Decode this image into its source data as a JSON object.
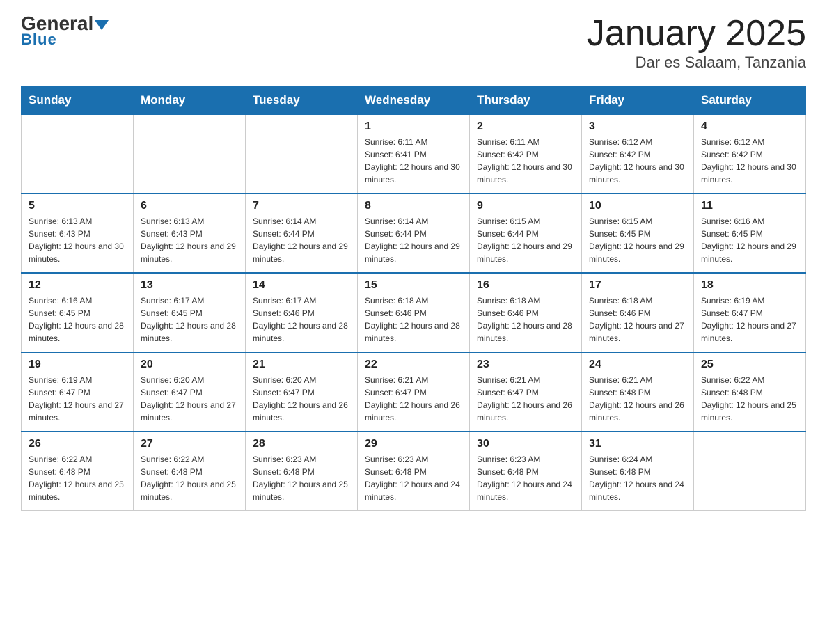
{
  "header": {
    "logo_main": "General",
    "logo_sub": "Blue",
    "month_title": "January 2025",
    "location": "Dar es Salaam, Tanzania"
  },
  "weekdays": [
    "Sunday",
    "Monday",
    "Tuesday",
    "Wednesday",
    "Thursday",
    "Friday",
    "Saturday"
  ],
  "weeks": [
    [
      {
        "day": "",
        "info": ""
      },
      {
        "day": "",
        "info": ""
      },
      {
        "day": "",
        "info": ""
      },
      {
        "day": "1",
        "info": "Sunrise: 6:11 AM\nSunset: 6:41 PM\nDaylight: 12 hours and 30 minutes."
      },
      {
        "day": "2",
        "info": "Sunrise: 6:11 AM\nSunset: 6:42 PM\nDaylight: 12 hours and 30 minutes."
      },
      {
        "day": "3",
        "info": "Sunrise: 6:12 AM\nSunset: 6:42 PM\nDaylight: 12 hours and 30 minutes."
      },
      {
        "day": "4",
        "info": "Sunrise: 6:12 AM\nSunset: 6:42 PM\nDaylight: 12 hours and 30 minutes."
      }
    ],
    [
      {
        "day": "5",
        "info": "Sunrise: 6:13 AM\nSunset: 6:43 PM\nDaylight: 12 hours and 30 minutes."
      },
      {
        "day": "6",
        "info": "Sunrise: 6:13 AM\nSunset: 6:43 PM\nDaylight: 12 hours and 29 minutes."
      },
      {
        "day": "7",
        "info": "Sunrise: 6:14 AM\nSunset: 6:44 PM\nDaylight: 12 hours and 29 minutes."
      },
      {
        "day": "8",
        "info": "Sunrise: 6:14 AM\nSunset: 6:44 PM\nDaylight: 12 hours and 29 minutes."
      },
      {
        "day": "9",
        "info": "Sunrise: 6:15 AM\nSunset: 6:44 PM\nDaylight: 12 hours and 29 minutes."
      },
      {
        "day": "10",
        "info": "Sunrise: 6:15 AM\nSunset: 6:45 PM\nDaylight: 12 hours and 29 minutes."
      },
      {
        "day": "11",
        "info": "Sunrise: 6:16 AM\nSunset: 6:45 PM\nDaylight: 12 hours and 29 minutes."
      }
    ],
    [
      {
        "day": "12",
        "info": "Sunrise: 6:16 AM\nSunset: 6:45 PM\nDaylight: 12 hours and 28 minutes."
      },
      {
        "day": "13",
        "info": "Sunrise: 6:17 AM\nSunset: 6:45 PM\nDaylight: 12 hours and 28 minutes."
      },
      {
        "day": "14",
        "info": "Sunrise: 6:17 AM\nSunset: 6:46 PM\nDaylight: 12 hours and 28 minutes."
      },
      {
        "day": "15",
        "info": "Sunrise: 6:18 AM\nSunset: 6:46 PM\nDaylight: 12 hours and 28 minutes."
      },
      {
        "day": "16",
        "info": "Sunrise: 6:18 AM\nSunset: 6:46 PM\nDaylight: 12 hours and 28 minutes."
      },
      {
        "day": "17",
        "info": "Sunrise: 6:18 AM\nSunset: 6:46 PM\nDaylight: 12 hours and 27 minutes."
      },
      {
        "day": "18",
        "info": "Sunrise: 6:19 AM\nSunset: 6:47 PM\nDaylight: 12 hours and 27 minutes."
      }
    ],
    [
      {
        "day": "19",
        "info": "Sunrise: 6:19 AM\nSunset: 6:47 PM\nDaylight: 12 hours and 27 minutes."
      },
      {
        "day": "20",
        "info": "Sunrise: 6:20 AM\nSunset: 6:47 PM\nDaylight: 12 hours and 27 minutes."
      },
      {
        "day": "21",
        "info": "Sunrise: 6:20 AM\nSunset: 6:47 PM\nDaylight: 12 hours and 26 minutes."
      },
      {
        "day": "22",
        "info": "Sunrise: 6:21 AM\nSunset: 6:47 PM\nDaylight: 12 hours and 26 minutes."
      },
      {
        "day": "23",
        "info": "Sunrise: 6:21 AM\nSunset: 6:47 PM\nDaylight: 12 hours and 26 minutes."
      },
      {
        "day": "24",
        "info": "Sunrise: 6:21 AM\nSunset: 6:48 PM\nDaylight: 12 hours and 26 minutes."
      },
      {
        "day": "25",
        "info": "Sunrise: 6:22 AM\nSunset: 6:48 PM\nDaylight: 12 hours and 25 minutes."
      }
    ],
    [
      {
        "day": "26",
        "info": "Sunrise: 6:22 AM\nSunset: 6:48 PM\nDaylight: 12 hours and 25 minutes."
      },
      {
        "day": "27",
        "info": "Sunrise: 6:22 AM\nSunset: 6:48 PM\nDaylight: 12 hours and 25 minutes."
      },
      {
        "day": "28",
        "info": "Sunrise: 6:23 AM\nSunset: 6:48 PM\nDaylight: 12 hours and 25 minutes."
      },
      {
        "day": "29",
        "info": "Sunrise: 6:23 AM\nSunset: 6:48 PM\nDaylight: 12 hours and 24 minutes."
      },
      {
        "day": "30",
        "info": "Sunrise: 6:23 AM\nSunset: 6:48 PM\nDaylight: 12 hours and 24 minutes."
      },
      {
        "day": "31",
        "info": "Sunrise: 6:24 AM\nSunset: 6:48 PM\nDaylight: 12 hours and 24 minutes."
      },
      {
        "day": "",
        "info": ""
      }
    ]
  ]
}
